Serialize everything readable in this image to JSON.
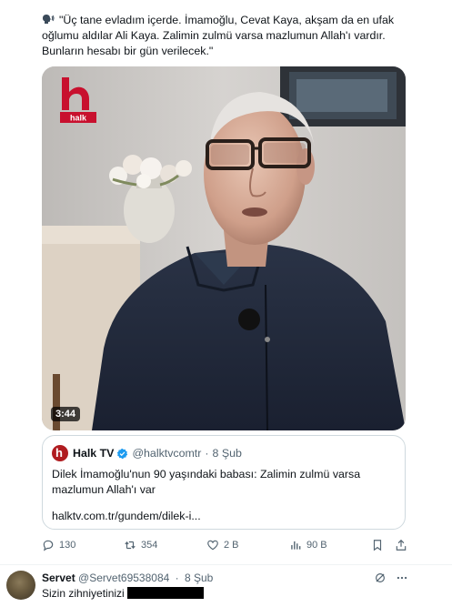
{
  "tweet": {
    "text": "\"Üç tane evladım içerde. İmamoğlu, Cevat Kaya, akşam da en ufak oğlumu aldılar Ali Kaya. Zalimin zulmü varsa mazlumun Allah'ı vardır. Bunların hesabı bir gün verilecek.\"",
    "speaker_icon": "speaking-head-icon"
  },
  "video": {
    "duration": "3:44",
    "logo_text": "halk",
    "logo_color": "#c8102e"
  },
  "quote": {
    "name": "Halk TV",
    "handle": "@halktvcomtr",
    "separator": "·",
    "date": "8 Şub",
    "text": "Dilek İmamoğlu'nun 90 yaşındaki babası: Zalimin zulmü varsa mazlumun Allah'ı var",
    "link": "halktv.com.tr/gundem/dilek-i..."
  },
  "actions": {
    "replies": "130",
    "retweets": "354",
    "likes": "2 B",
    "views": "90 B"
  },
  "reply": {
    "name": "Servet",
    "handle": "@Servet69538084",
    "separator": "·",
    "date": "8 Şub",
    "text": "Sizin zihniyetinizi"
  },
  "colors": {
    "text": "#0f1419",
    "muted": "#536471",
    "border": "#cfd9de",
    "verified": "#1d9bf0",
    "brand_red": "#b01c20"
  }
}
